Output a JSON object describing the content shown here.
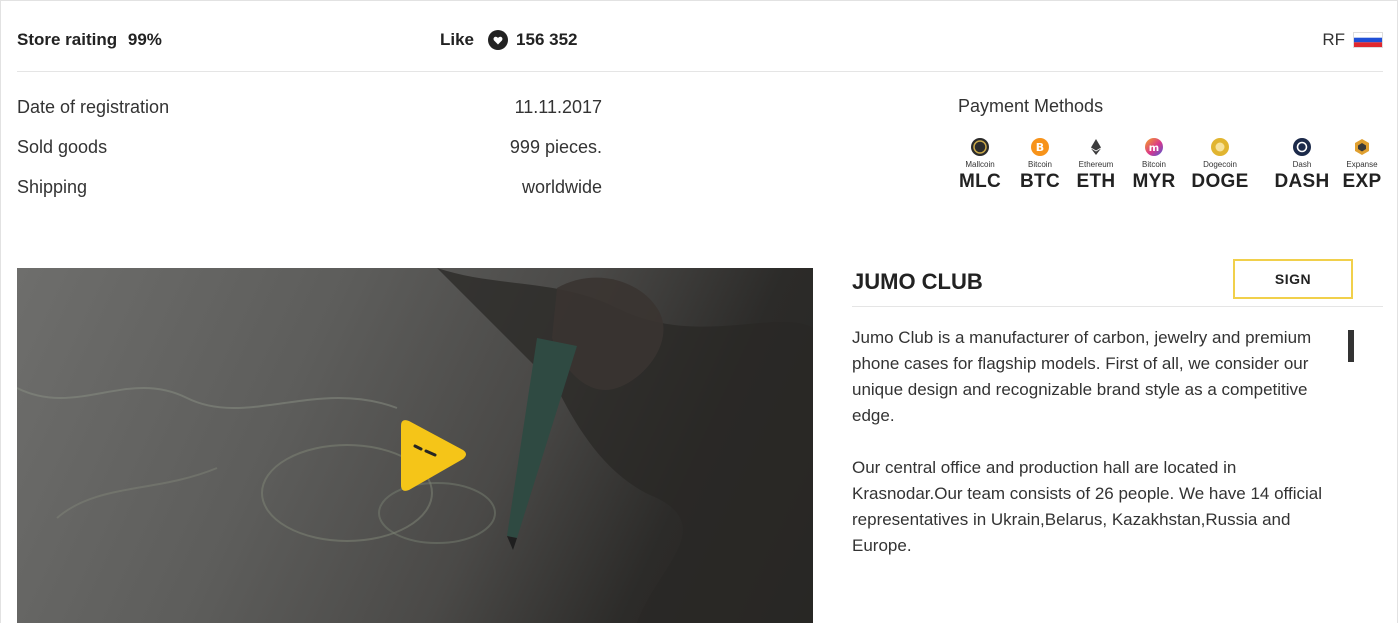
{
  "topbar": {
    "rating_label": "Store raiting",
    "rating_value": "99%",
    "like_label": "Like",
    "like_count": "156 352",
    "region": "RF"
  },
  "info": [
    {
      "label": "Date of registration",
      "value": "11.11.2017"
    },
    {
      "label": "Sold goods",
      "value": "999 pieces."
    },
    {
      "label": "Shipping",
      "value": "worldwide"
    }
  ],
  "payment": {
    "title": "Payment Methods",
    "coins": [
      {
        "name": "Mallcoin",
        "code": "MLC",
        "color": "#2b2b2b"
      },
      {
        "name": "Bitcoin",
        "code": "BTC",
        "color": "#f7931a"
      },
      {
        "name": "Ethereum",
        "code": "ETH",
        "color": "#3c3c3d"
      },
      {
        "name": "Bitcoin",
        "code": "MYR",
        "color": "#d9368b"
      },
      {
        "name": "Dogecoin",
        "code": "DOGE",
        "color": "#e1b530"
      },
      {
        "name": "Dash",
        "code": "DASH",
        "color": "#1c2a4a"
      },
      {
        "name": "Expanse",
        "code": "EXP",
        "color": "#e0a030"
      }
    ]
  },
  "video": {
    "play_color": "#f5c518"
  },
  "club": {
    "title": "JUMO CLUB",
    "sign_label": "SIGN",
    "paragraphs": [
      "Jumo Club is a manufacturer of carbon, jewelry and premium phone cases for flagship models. First of all, we consider our unique design and recognizable brand style as a competitive edge.",
      "Our central office and  production hall are located in Krasnodar.Our team consists of 26 people. We have 14 official representatives in Ukrain,Belarus, Kazakhstan,Russia and Europe."
    ]
  },
  "colors": {
    "accent": "#f5c518",
    "sign_border": "#f1d04b",
    "flag_white": "#ffffff",
    "flag_blue": "#1f4fd6",
    "flag_red": "#e0282e"
  }
}
